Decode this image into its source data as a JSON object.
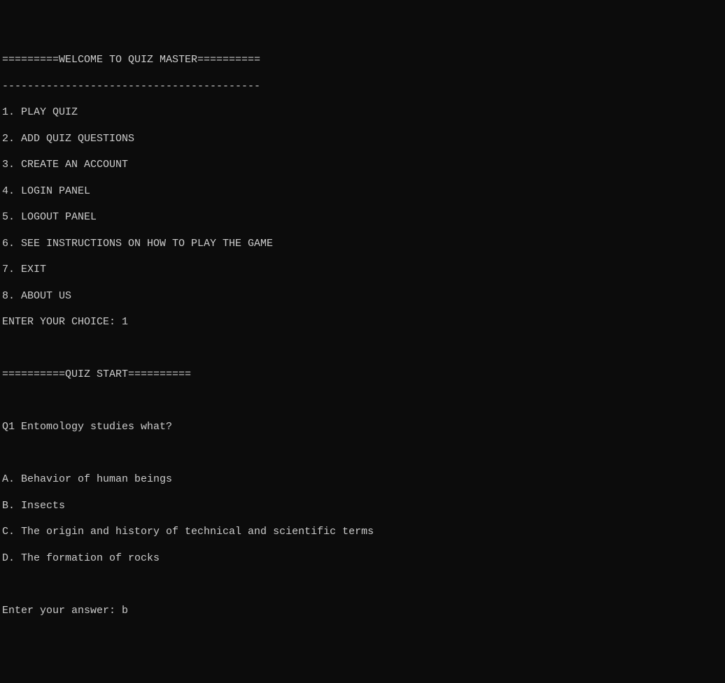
{
  "header": {
    "title_line": "=========WELCOME TO QUIZ MASTER==========",
    "divider": "-----------------------------------------"
  },
  "menu": {
    "items": [
      "1. PLAY QUIZ",
      "2. ADD QUIZ QUESTIONS",
      "3. CREATE AN ACCOUNT",
      "4. LOGIN PANEL",
      "5. LOGOUT PANEL",
      "6. SEE INSTRUCTIONS ON HOW TO PLAY THE GAME",
      "7. EXIT",
      "8. ABOUT US"
    ],
    "choice_prompt": "ENTER YOUR CHOICE: ",
    "choice_value": "1"
  },
  "quiz": {
    "start_line": "==========QUIZ START==========",
    "question": "Q1 Entomology studies what?",
    "options": [
      "A. Behavior of human beings",
      "B. Insects",
      "C. The origin and history of technical and scientific terms",
      "D. The formation of rocks"
    ],
    "answer_prompt": "Enter your answer: ",
    "answer_value": "b"
  }
}
